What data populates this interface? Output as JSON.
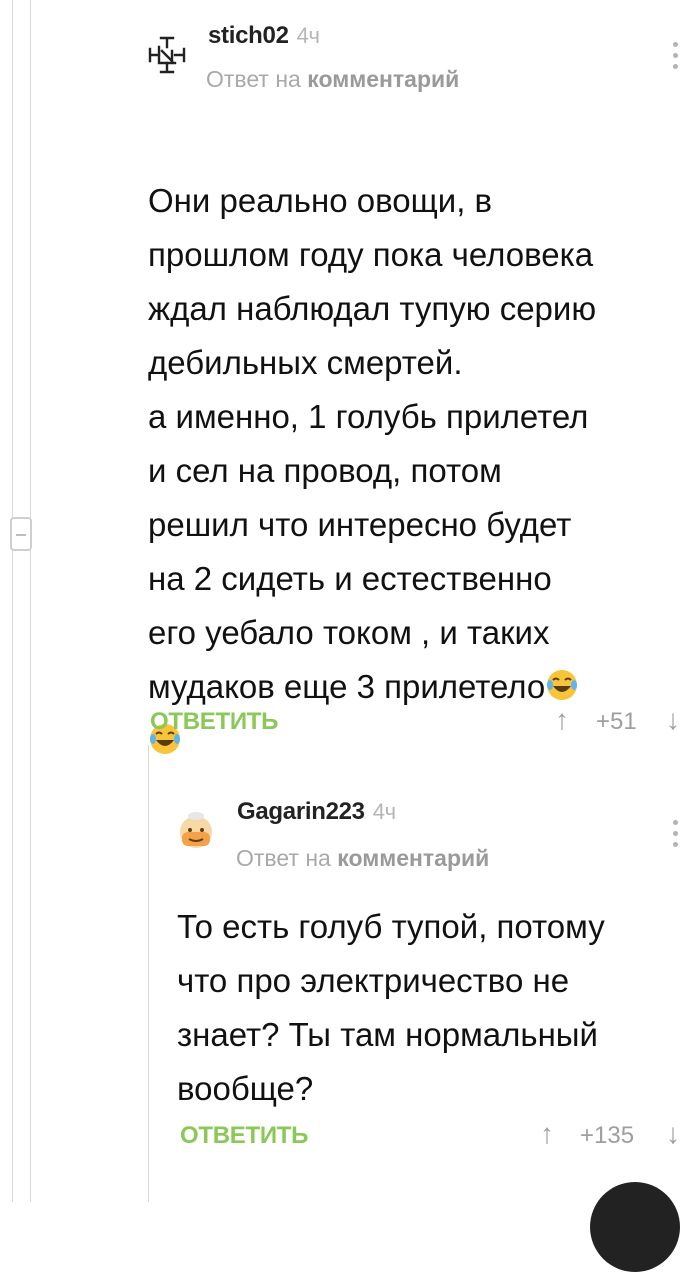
{
  "comments": [
    {
      "author": "stich02",
      "time": "4ч",
      "reply_prefix": "Ответ на",
      "reply_target": "комментарий",
      "body": "Они реально овощи, в\nпрошлом году пока человека\nждал наблюдал тупую серию\nдебильных смертей.\nа именно, 1 голубь прилетел\nи сел на провод, потом\nрешил что интересно будет\nна 2 сидеть и естественно\nего уебало током , и таких\nмудаков еще 3 прилетело",
      "reply_label": "ОТВЕТИТЬ",
      "rating": "+51",
      "avatar_icon": "rammstein-logo-icon",
      "emoji": "face-with-tears-of-joy"
    },
    {
      "author": "Gagarin223",
      "time": "4ч",
      "reply_prefix": "Ответ на",
      "reply_target": "комментарий",
      "body": "То есть голуб тупой, потому\nчто про электричество не\nзнает? Ты там нормальный\nвообще?",
      "reply_label": "ОТВЕТИТЬ",
      "rating": "+135",
      "avatar_icon": "cartoon-face-icon"
    }
  ],
  "colors": {
    "reply_green": "#8ac858",
    "muted_gray": "#9e9e9e",
    "thread_line": "#d9d9d9"
  }
}
